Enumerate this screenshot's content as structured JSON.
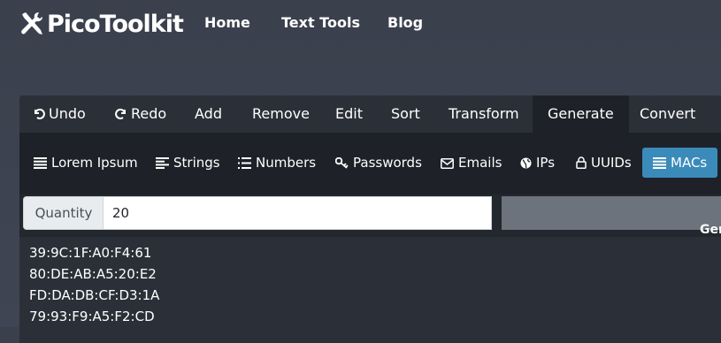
{
  "brand": {
    "part1": "Pico",
    "part2": "Toolkit"
  },
  "nav": [
    {
      "label": "Home"
    },
    {
      "label": "Text Tools"
    },
    {
      "label": "Blog"
    }
  ],
  "menu": [
    {
      "label": "Undo",
      "icon": "undo-icon"
    },
    {
      "label": "Redo",
      "icon": "redo-icon"
    },
    {
      "label": "Add"
    },
    {
      "label": "Remove"
    },
    {
      "label": "Edit"
    },
    {
      "label": "Sort"
    },
    {
      "label": "Transform"
    },
    {
      "label": "Generate",
      "active": true
    },
    {
      "label": "Convert"
    }
  ],
  "submenu": [
    {
      "label": "Lorem Ipsum",
      "icon": "align-justify-icon"
    },
    {
      "label": "Strings",
      "icon": "align-left-icon"
    },
    {
      "label": "Numbers",
      "icon": "list-ol-icon"
    },
    {
      "label": "Passwords",
      "icon": "key-icon"
    },
    {
      "label": "Emails",
      "icon": "envelope-icon"
    },
    {
      "label": "IPs",
      "icon": "globe-icon"
    },
    {
      "label": "UUIDs",
      "icon": "lock-icon"
    },
    {
      "label": "MACs",
      "icon": "list-icon",
      "active": true
    }
  ],
  "quantity": {
    "label": "Quantity",
    "value": "20"
  },
  "generate_button": {
    "label": "Gen"
  },
  "output_lines": [
    "39:9C:1F:A0:F4:61",
    "80:DE:AB:A5:20:E2",
    "FD:DA:DB:CF:D3:1A",
    "79:93:F9:A5:F2:CD"
  ],
  "colors": {
    "accent": "#3b8bba",
    "background": "#3b4252",
    "panel": "#23272e"
  }
}
